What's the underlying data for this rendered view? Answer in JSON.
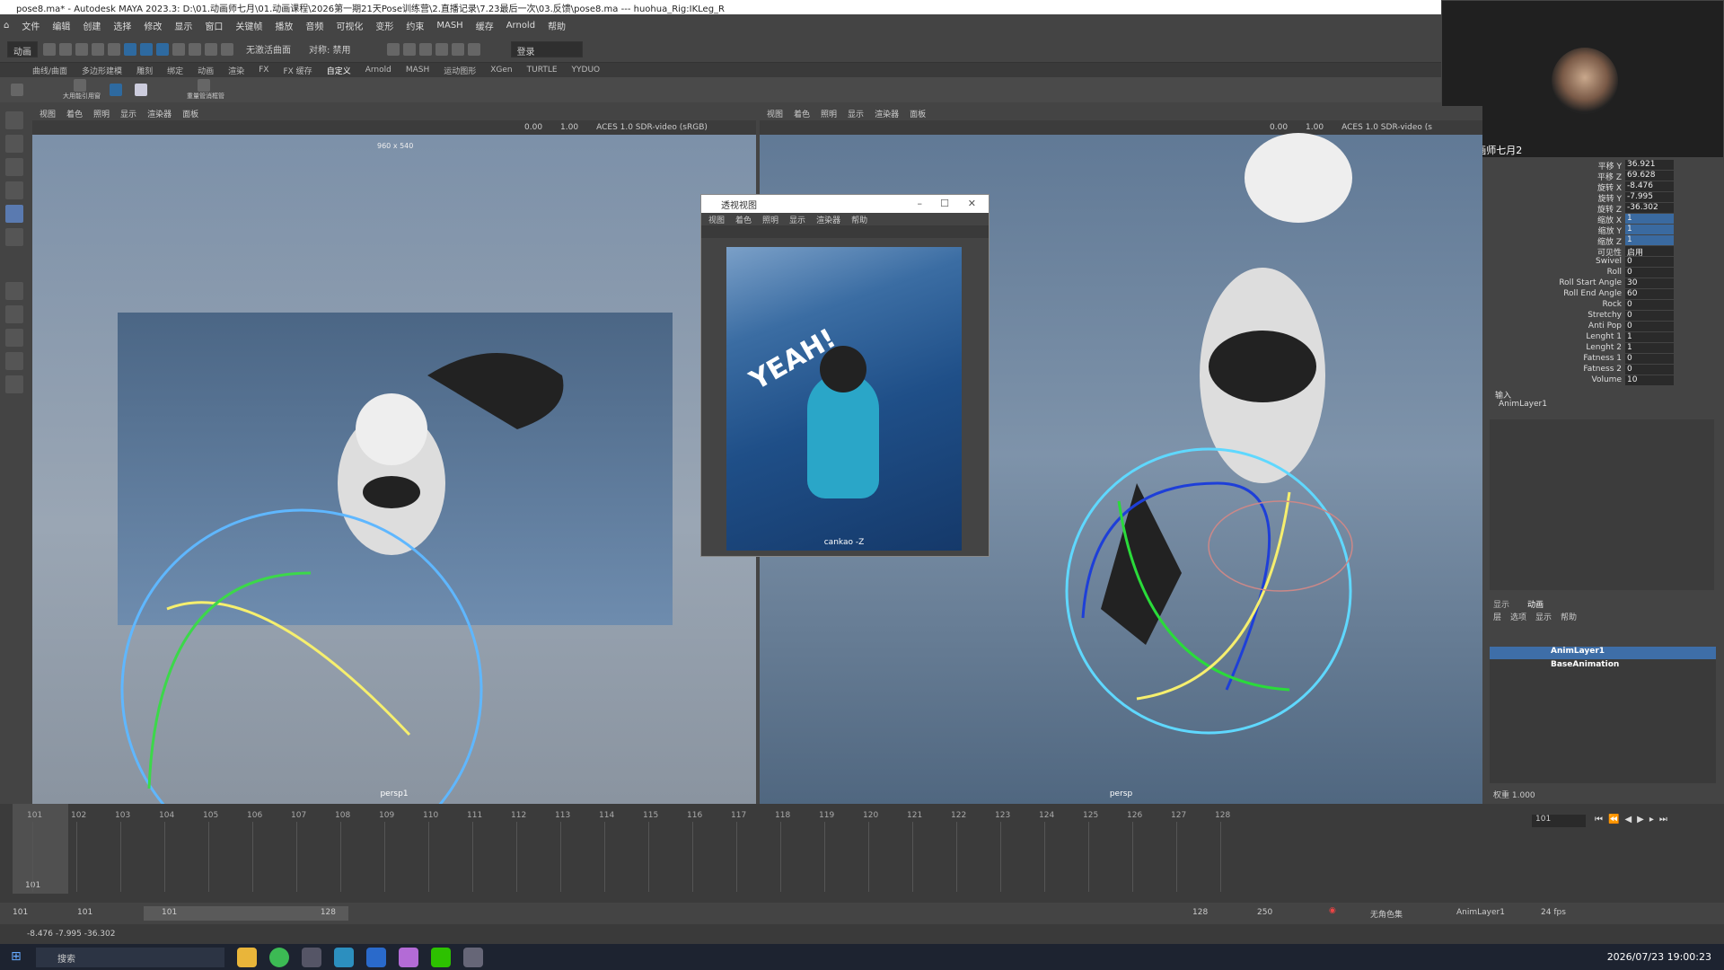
{
  "window": {
    "title": "pose8.ma* - Autodesk MAYA 2023.3: D:\\01.动画师七月\\01.动画课程\\2026第一期21天Pose训练营\\2.直播记录\\7.23最后一次\\03.反馈\\pose8.ma    ---    huohua_Rig:IKLeg_R"
  },
  "menubar": [
    "文件",
    "编辑",
    "创建",
    "选择",
    "修改",
    "显示",
    "窗口",
    "关键帧",
    "播放",
    "音频",
    "可视化",
    "变形",
    "约束",
    "MASH",
    "缓存",
    "Arnold",
    "帮助"
  ],
  "statusline": {
    "mode": "动画",
    "surface": "无激活曲面",
    "symmetry": "对称: 禁用",
    "login": "登录"
  },
  "shelf_tabs": [
    "曲线/曲面",
    "多边形建模",
    "雕刻",
    "绑定",
    "动画",
    "渲染",
    "FX",
    "FX 缓存",
    "自定义",
    "Arnold",
    "MASH",
    "运动图形",
    "XGen",
    "TURTLE",
    "YYDUO"
  ],
  "shelf_buttons": [
    "大用能引用窗",
    "重量管消框管"
  ],
  "viewport_menu": [
    "视图",
    "着色",
    "照明",
    "显示",
    "渲染器",
    "面板"
  ],
  "viewport_left": {
    "gate": "960 x 540",
    "val1": "0.00",
    "val2": "1.00",
    "colorspace": "ACES 1.0 SDR-video (sRGB)",
    "camera": "persp1"
  },
  "viewport_right": {
    "val1": "0.00",
    "val2": "1.00",
    "colorspace": "ACES 1.0 SDR-video (s",
    "camera": "persp"
  },
  "float_window": {
    "title": "透视视图",
    "menu": [
      "视图",
      "着色",
      "照明",
      "显示",
      "渲染器",
      "帮助"
    ],
    "photo_text": "YEAH!",
    "caption": "cankao -Z"
  },
  "webcam": {
    "name": "动画师七月2"
  },
  "channel_box": [
    {
      "n": "平移 Y",
      "v": "36.921",
      "k": false
    },
    {
      "n": "平移 Z",
      "v": "69.628",
      "k": false
    },
    {
      "n": "旋转 X",
      "v": "-8.476",
      "k": false
    },
    {
      "n": "旋转 Y",
      "v": "-7.995",
      "k": false
    },
    {
      "n": "旋转 Z",
      "v": "-36.302",
      "k": false
    },
    {
      "n": "缩放 X",
      "v": "1",
      "k": true
    },
    {
      "n": "缩放 Y",
      "v": "1",
      "k": true
    },
    {
      "n": "缩放 Z",
      "v": "1",
      "k": true
    },
    {
      "n": "可见性",
      "v": "启用",
      "k": false
    },
    {
      "n": "Swivel",
      "v": "0",
      "k": false
    },
    {
      "n": "Roll",
      "v": "0",
      "k": false
    },
    {
      "n": "Roll Start Angle",
      "v": "30",
      "k": false
    },
    {
      "n": "Roll End Angle",
      "v": "60",
      "k": false
    },
    {
      "n": "Rock",
      "v": "0",
      "k": false
    },
    {
      "n": "Stretchy",
      "v": "0",
      "k": false
    },
    {
      "n": "Anti Pop",
      "v": "0",
      "k": false
    },
    {
      "n": "Lenght 1",
      "v": "1",
      "k": false
    },
    {
      "n": "Lenght 2",
      "v": "1",
      "k": false
    },
    {
      "n": "Fatness 1",
      "v": "0",
      "k": false
    },
    {
      "n": "Fatness 2",
      "v": "0",
      "k": false
    },
    {
      "n": "Volume",
      "v": "10",
      "k": false
    }
  ],
  "inputs": {
    "label": "输入",
    "layer": "AnimLayer1"
  },
  "layer_editor": {
    "tabs": [
      "显示",
      "动画"
    ],
    "menu": [
      "层",
      "选项",
      "显示",
      "帮助"
    ],
    "rows": [
      {
        "name": "AnimLayer1",
        "selected": true
      },
      {
        "name": "BaseAnimation",
        "selected": false
      }
    ],
    "weight_label": "权重",
    "weight_value": "1.000"
  },
  "timeline": {
    "ticks": [
      "101",
      "102",
      "103",
      "104",
      "105",
      "106",
      "107",
      "108",
      "109",
      "110",
      "111",
      "112",
      "113",
      "114",
      "115",
      "116",
      "117",
      "118",
      "119",
      "120",
      "121",
      "122",
      "123",
      "124",
      "125",
      "126",
      "127",
      "128"
    ],
    "current": "101",
    "current_field": "101"
  },
  "range": {
    "start": "101",
    "start2": "101",
    "inner_start": "101",
    "inner_end": "128",
    "end": "128",
    "end2": "250",
    "char_set": "无角色集",
    "anim_layer": "AnimLayer1",
    "fps": "24 fps"
  },
  "cmdline": {
    "text": "-8.476  -7.995  -36.302"
  },
  "taskbar": {
    "search": "搜索",
    "clock": "2026/07/23 19:00:23"
  }
}
